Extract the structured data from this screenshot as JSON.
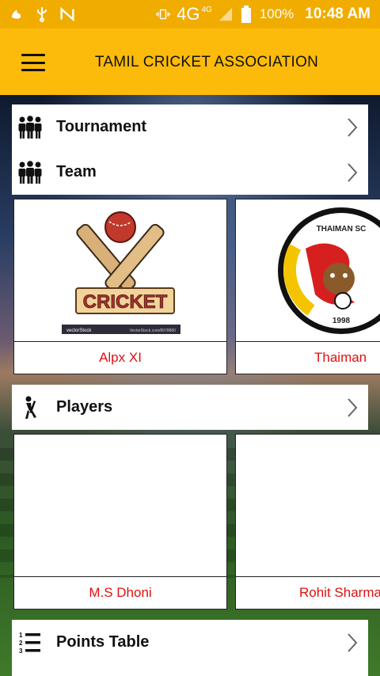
{
  "status_bar": {
    "network": "4G",
    "network_badge": "4G",
    "battery": "100%",
    "time": "10:48 AM"
  },
  "app_bar": {
    "title": "TAMIL CRICKET ASSOCIATION"
  },
  "menu": {
    "tournament_label": "Tournament",
    "team_label": "Team",
    "players_label": "Players",
    "points_table_label": "Points Table"
  },
  "teams": [
    {
      "name": "Alpx XI",
      "logo_text": "CRICKET",
      "logo_footer_left": "vectorStock",
      "logo_footer_right": "VectorStock.com/8978880"
    },
    {
      "name": "Thaiman",
      "logo_text": "THAIMAN SC",
      "logo_year": "1998"
    }
  ],
  "players": [
    {
      "name": "M.S Dhoni"
    },
    {
      "name": "Rohit Sharma"
    }
  ],
  "colors": {
    "status_bar": "#f1ac00",
    "app_bar": "#fcbb0a",
    "caption_red": "#e01010"
  }
}
